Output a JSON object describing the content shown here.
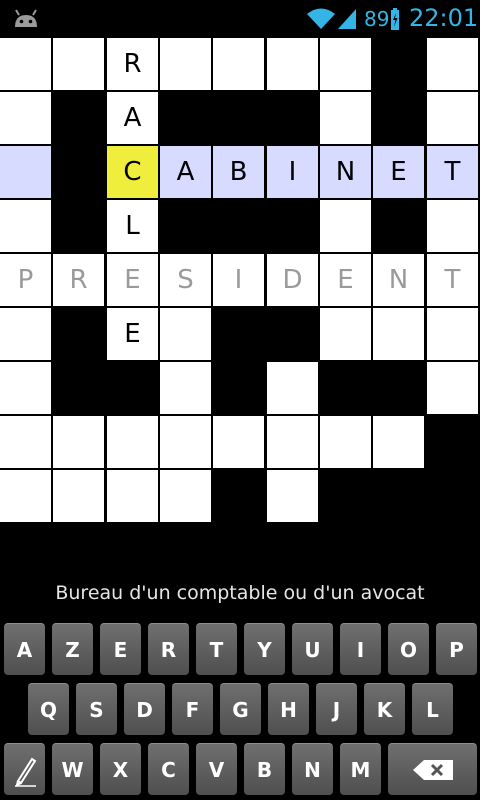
{
  "status": {
    "battery_percent": "89",
    "time": "22:01",
    "icons": [
      "android-icon",
      "wifi-icon",
      "signal-icon",
      "battery-icon"
    ],
    "accent_color": "#33b5e5"
  },
  "crossword": {
    "current_clue": "Bureau d'un comptable ou d'un avocat",
    "highlight_color": "#d6dbff",
    "cursor_color": "#f0ee3c",
    "rows": [
      [
        "",
        "",
        "R",
        "",
        "",
        "",
        "",
        "#",
        ""
      ],
      [
        "",
        "#",
        "A",
        "#",
        "#",
        "#",
        "",
        "#",
        ""
      ],
      [
        "",
        "#",
        "C",
        "A",
        "B",
        "I",
        "N",
        "E",
        "T"
      ],
      [
        "",
        "#",
        "L",
        "#",
        "#",
        "#",
        "",
        "#",
        ""
      ],
      [
        "P",
        "R",
        "E",
        "S",
        "I",
        "D",
        "E",
        "N",
        "T"
      ],
      [
        "",
        "#",
        "E",
        "",
        "#",
        "#",
        "",
        "",
        ""
      ],
      [
        "",
        "#",
        "#",
        "",
        "#",
        "",
        "#",
        "#",
        ""
      ],
      [
        "",
        "",
        "",
        "",
        "",
        "",
        "",
        "",
        "#"
      ],
      [
        "",
        "",
        "",
        "",
        "#",
        "",
        "#",
        "#",
        "#"
      ]
    ],
    "dim_row": 4,
    "highlight_row": 2,
    "cursor": [
      2,
      2
    ]
  },
  "keyboard": {
    "row1": [
      "A",
      "Z",
      "E",
      "R",
      "T",
      "Y",
      "U",
      "I",
      "O",
      "P"
    ],
    "row2": [
      "Q",
      "S",
      "D",
      "F",
      "G",
      "H",
      "J",
      "K",
      "L"
    ],
    "row3": [
      "W",
      "X",
      "C",
      "V",
      "B",
      "N",
      "M"
    ],
    "left_key_icon": "pencil-icon",
    "right_key_icon": "backspace-icon"
  }
}
